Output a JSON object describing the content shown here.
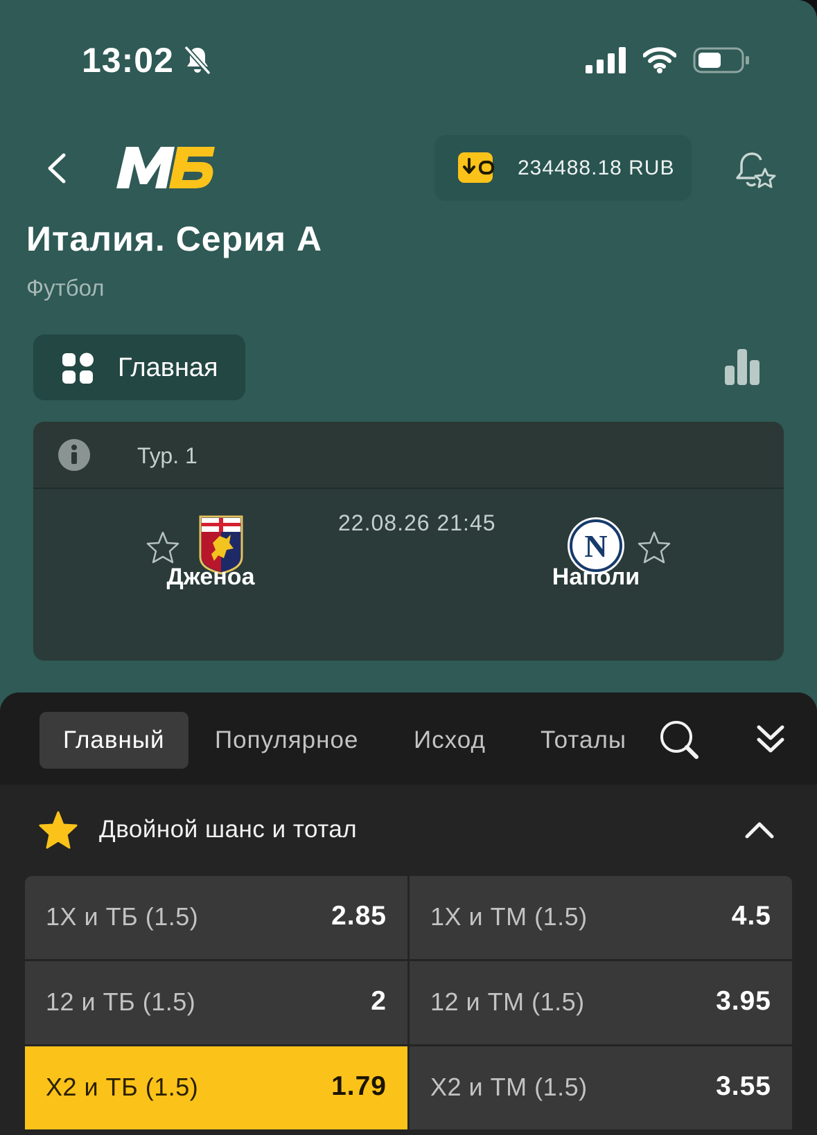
{
  "status_bar": {
    "time": "13:02"
  },
  "header": {
    "balance": "234488.18 RUB"
  },
  "league": {
    "title": "Италия. Серия А",
    "sport": "Футбол"
  },
  "main_chip": {
    "label": "Главная"
  },
  "match": {
    "round": "Тур. 1",
    "datetime": "22.08.26 21:45",
    "home_team": "Дженоа",
    "away_team": "Наполи"
  },
  "tabs": [
    {
      "label": "Главный",
      "active": true
    },
    {
      "label": "Популярное",
      "active": false
    },
    {
      "label": "Исход",
      "active": false
    },
    {
      "label": "Тоталы",
      "active": false
    }
  ],
  "section": {
    "title": "Двойной шанс и тотал"
  },
  "odds": [
    {
      "label": "1X и ТБ (1.5)",
      "value": "2.85",
      "selected": false
    },
    {
      "label": "1X и ТМ (1.5)",
      "value": "4.5",
      "selected": false
    },
    {
      "label": "12 и ТБ (1.5)",
      "value": "2",
      "selected": false
    },
    {
      "label": "12 и ТМ (1.5)",
      "value": "3.95",
      "selected": false
    },
    {
      "label": "X2 и ТБ (1.5)",
      "value": "1.79",
      "selected": true
    },
    {
      "label": "X2 и ТМ (1.5)",
      "value": "3.55",
      "selected": false
    }
  ],
  "colors": {
    "background": "#2f5a56",
    "accent": "#fbc21a",
    "sheet": "#242424"
  },
  "icons": [
    "bell-muted-icon",
    "signal-icon",
    "wifi-icon",
    "battery-icon",
    "back-icon",
    "logo",
    "wallet-icon",
    "bell-star-icon",
    "grid-icon",
    "stats-icon",
    "info-icon",
    "star-outline-icon",
    "search-icon",
    "double-chevron-down-icon",
    "star-filled-icon",
    "chevron-up-icon"
  ]
}
